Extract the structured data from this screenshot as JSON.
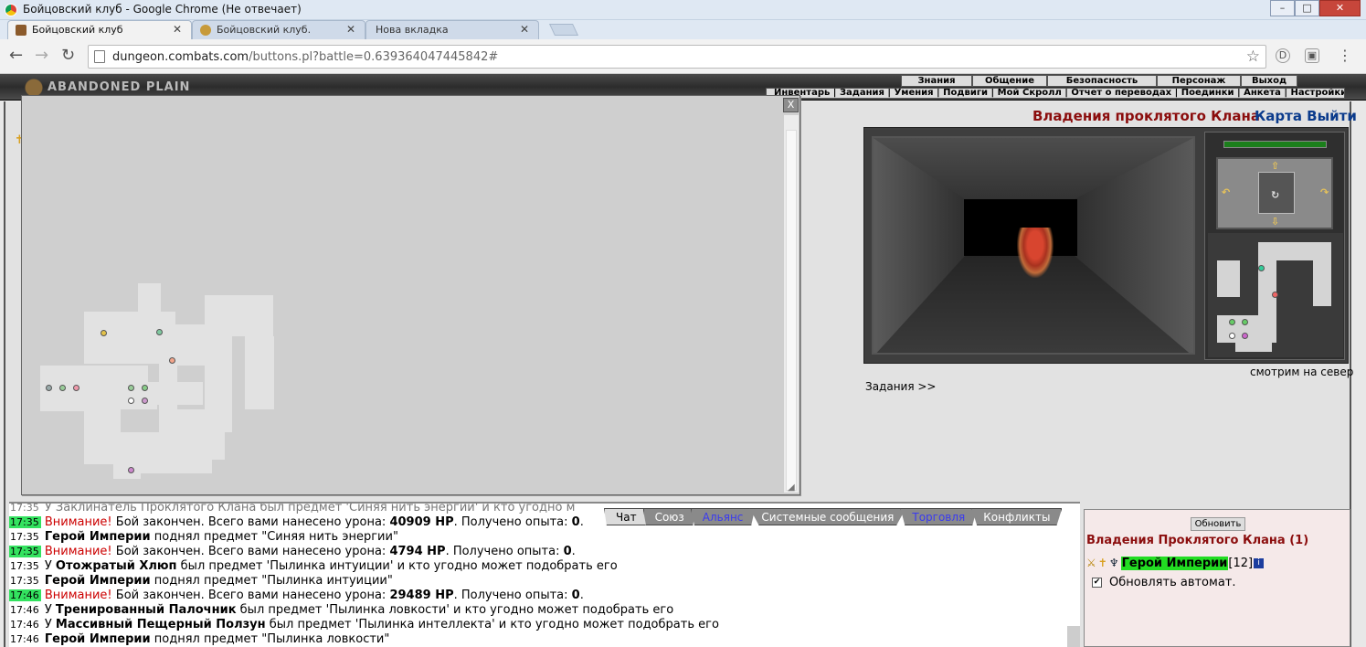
{
  "window": {
    "title": "Бойцовский клуб - Google Chrome (Не отвечает)"
  },
  "tabs": [
    {
      "label": "Бойцовский клуб"
    },
    {
      "label": "Бойцовский клуб."
    },
    {
      "label": "Нова вкладка"
    }
  ],
  "address": {
    "host": "dungeon.combats.com",
    "path": "/buttons.pl?battle=0.639364047445842#"
  },
  "game": {
    "logo": "ABANDONED PLAIN",
    "menu_top": [
      "Знания",
      "Общение",
      "Безопасность",
      "Персонаж",
      "Выход"
    ],
    "menu_sub": "Инвентарь | Задания | Умения | Подвиги | Мой Скролл | Отчет о переводах | Поединки | Анкета | Настройки"
  },
  "popup": {
    "close_label": "X"
  },
  "location": {
    "title": "Владения проклятого Клана",
    "map_link": "Карта",
    "exit_link": "Выйти",
    "facing": "смотрим на север",
    "tasks_link": "Задания >>",
    "hp_fraction": 1.0
  },
  "chat": {
    "first_line_partial": "У Заклинатель Проклятого Клана был предмет 'Синяя нить энергии' и кто угодно м",
    "tabs": [
      {
        "label": "Чат",
        "active": true
      },
      {
        "label": "Союз"
      },
      {
        "label": "Альянс",
        "blue": true
      },
      {
        "label": "Системные сообщения"
      },
      {
        "label": "Торговля",
        "blue": true
      },
      {
        "label": "Конфликты"
      }
    ],
    "lines": [
      {
        "time": "17:35",
        "hl": true,
        "warn": "Внимание!",
        "text": " Бой закончен. Всего вами нанесено урона: ",
        "b1": "40909 HP",
        "text2": ". Получено опыта: ",
        "b2": "0",
        "text3": "."
      },
      {
        "time": "17:35",
        "hl": false,
        "b0": "Герой Империи",
        "text": " поднял предмет \"Синяя нить энергии\""
      },
      {
        "time": "17:35",
        "hl": true,
        "warn": "Внимание!",
        "text": " Бой закончен. Всего вами нанесено урона: ",
        "b1": "4794 HP",
        "text2": ". Получено опыта: ",
        "b2": "0",
        "text3": "."
      },
      {
        "time": "17:35",
        "hl": false,
        "pre": "У ",
        "b0": "Отожратый Хлюп",
        "text": " был предмет 'Пылинка интуиции' и кто угодно может подобрать его"
      },
      {
        "time": "17:35",
        "hl": false,
        "b0": "Герой Империи",
        "text": " поднял предмет \"Пылинка интуиции\""
      },
      {
        "time": "17:46",
        "hl": true,
        "warn": "Внимание!",
        "text": " Бой закончен. Всего вами нанесено урона: ",
        "b1": "29489 HP",
        "text2": ". Получено опыта: ",
        "b2": "0",
        "text3": "."
      },
      {
        "time": "17:46",
        "hl": false,
        "pre": "У ",
        "b0": "Тренированный Палочник",
        "text": " был предмет 'Пылинка ловкости' и кто угодно может подобрать его"
      },
      {
        "time": "17:46",
        "hl": false,
        "pre": "У ",
        "b0": "Массивный Пещерный Ползун",
        "text": " был предмет 'Пылинка интеллекта' и кто угодно может подобрать его"
      },
      {
        "time": "17:46",
        "hl": false,
        "b0": "Герой Империи",
        "text": " поднял предмет \"Пылинка ловкости\""
      }
    ]
  },
  "who": {
    "refresh_label": "Обновить",
    "title": "Владения Проклятого Клана (1)",
    "player": {
      "name": "Герой Империи",
      "level": "[12]",
      "info": "i"
    },
    "auto_label": "Обновлять автомат.",
    "auto_checked": true
  },
  "colors": {
    "danger": "#cc0000",
    "timestamp_highlight": "#33e25f",
    "location_title": "#8b0d0d",
    "link": "#0b3b8c"
  }
}
